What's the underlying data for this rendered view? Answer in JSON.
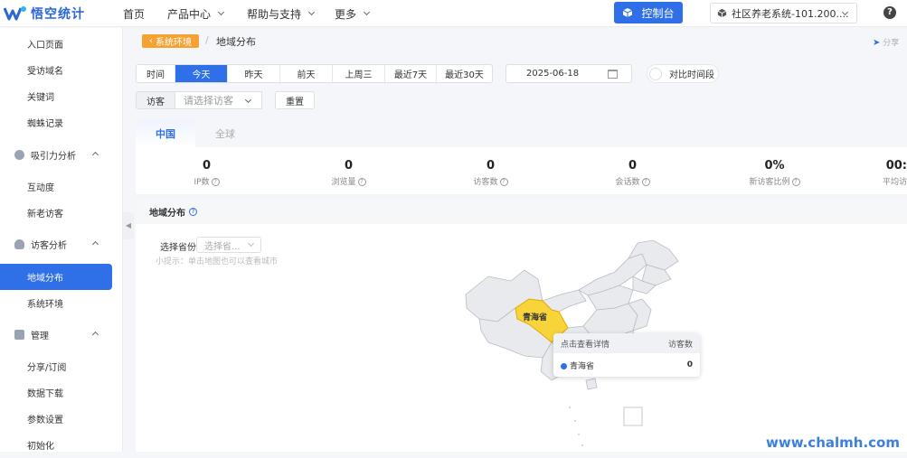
{
  "app": {
    "logo_text": "悟空统计"
  },
  "topnav": {
    "items": [
      {
        "label": "首页",
        "has_dropdown": false
      },
      {
        "label": "产品中心",
        "has_dropdown": true
      },
      {
        "label": "帮助与支持",
        "has_dropdown": true
      },
      {
        "label": "更多",
        "has_dropdown": true
      }
    ],
    "console_label": "控制台",
    "site_select_value": "社区养老系统-101.200....",
    "help_icon": "?"
  },
  "sidebar": {
    "items": [
      {
        "label": "入口页面",
        "type": "item"
      },
      {
        "label": "受访域名",
        "type": "item"
      },
      {
        "label": "关键词",
        "type": "item"
      },
      {
        "label": "蜘蛛记录",
        "type": "item"
      },
      {
        "label": "吸引力分析",
        "type": "group"
      },
      {
        "label": "互动度",
        "type": "item"
      },
      {
        "label": "新老访客",
        "type": "item"
      },
      {
        "label": "访客分析",
        "type": "group"
      },
      {
        "label": "地域分布",
        "type": "item",
        "active": true
      },
      {
        "label": "系统环境",
        "type": "item"
      },
      {
        "label": "管理",
        "type": "group"
      },
      {
        "label": "分享/订阅",
        "type": "item"
      },
      {
        "label": "数据下载",
        "type": "item"
      },
      {
        "label": "参数设置",
        "type": "item"
      },
      {
        "label": "初始化",
        "type": "item"
      }
    ]
  },
  "breadcrumb": {
    "back_label": "系统环境",
    "separator": "/",
    "current": "地域分布",
    "share_label": "分享"
  },
  "date_filter": {
    "tabs": [
      "时间",
      "今天",
      "昨天",
      "前天",
      "上周三",
      "最近7天",
      "最近30天"
    ],
    "active_tab": "今天",
    "date_value": "2025-06-18",
    "compare_label": "对比时间段"
  },
  "visitor_filter": {
    "label": "访客",
    "placeholder": "请选择访客",
    "reset_label": "重置"
  },
  "region_tabs": {
    "items": [
      "中国",
      "全球"
    ],
    "active": "中国"
  },
  "stats": [
    {
      "value": "0",
      "label": "IP数"
    },
    {
      "value": "0",
      "label": "浏览量"
    },
    {
      "value": "0",
      "label": "访客数"
    },
    {
      "value": "0",
      "label": "会话数"
    },
    {
      "value": "0%",
      "label": "新访客比例"
    },
    {
      "value": "00:",
      "label": "平均访"
    }
  ],
  "map_panel": {
    "title": "地域分布",
    "province_label": "选择省份",
    "province_placeholder": "选择省...",
    "hint": "小提示：单击地图也可以查看城市",
    "highlight_label": "青海省",
    "colors": {
      "highlight": "#f8d43b",
      "land": "#e9eaee",
      "border": "#b9bcc4"
    }
  },
  "tooltip": {
    "head_left": "点击查看详情",
    "head_right": "访客数",
    "row_name": "青海省",
    "row_value": "0"
  },
  "watermark": "www.chalmh.com"
}
